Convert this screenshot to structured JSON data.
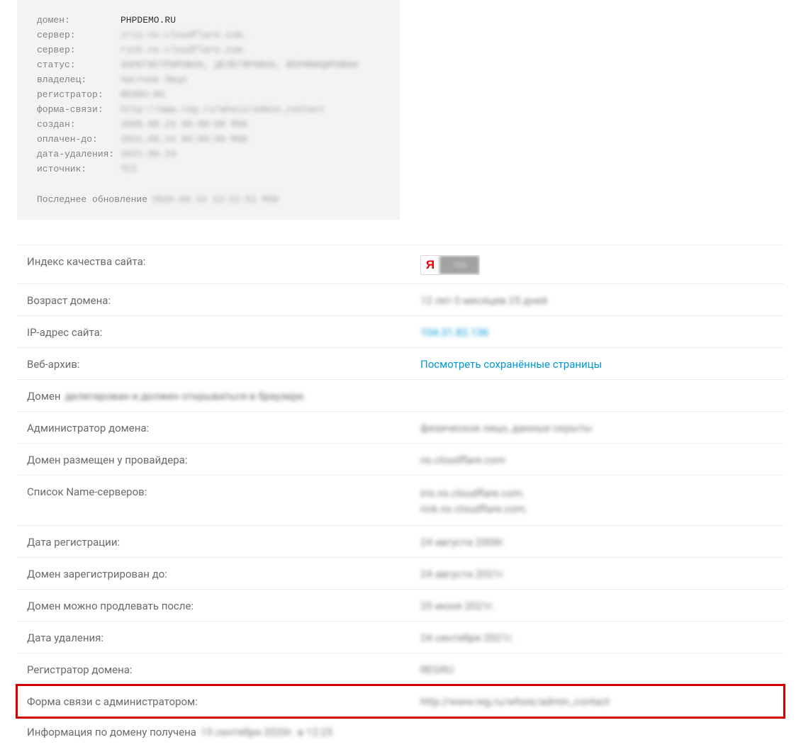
{
  "whois": {
    "rows": [
      {
        "label": "домен:",
        "value": "PHPDEMO.RU",
        "clear": true
      },
      {
        "label": "сервер:",
        "value": "iris.ns.cloudflare.com."
      },
      {
        "label": "сервер:",
        "value": "rick.ns.cloudflare.com."
      },
      {
        "label": "статус:",
        "value": "ЗАРЕГИСТРИРОВАН, ДЕЛЕГИРОВАН, ВЕРИФИЦИРОВАН"
      },
      {
        "label": "владелец:",
        "value": "Частное Лицо"
      },
      {
        "label": "регистратор:",
        "value": "REGRU-RU"
      },
      {
        "label": "форма-связи:",
        "value": "http://www.reg.ru/whois/admin_contact"
      },
      {
        "label": "создан:",
        "value": "2008.08.24 00:00:00 MSK"
      },
      {
        "label": "оплачен-до:",
        "value": "2021.08.24 00:00:00 MSK"
      },
      {
        "label": "дата-удаления:",
        "value": "2021.09.24"
      },
      {
        "label": "источник:",
        "value": "TCI"
      }
    ],
    "footer_label": "Последнее обновление",
    "footer_value": "2020.09.15 12:21:51 MSK"
  },
  "info": {
    "quality_label": "Индекс качества сайта:",
    "quality_badge_ya": "Я",
    "quality_badge_val": "120",
    "age_label": "Возраст домена:",
    "age_value": "12 лет 0 месяцев 25 дней",
    "ip_label": "IP-адрес сайта:",
    "ip_value": "104.31.82.136",
    "archive_label": "Веб-архив:",
    "archive_link": "Посмотреть сохранённые страницы",
    "domain_lead": "Домен",
    "domain_status": "делегирован и должен открываться в браузере.",
    "admin_label": "Администратор домена:",
    "admin_value": "физическое лицо, данные скрыты",
    "provider_label": "Домен размещен у провайдера:",
    "provider_value": "ns.cloudflare.com",
    "ns_label": "Список Name-серверов:",
    "ns_value_1": "iris.ns.cloudflare.com.",
    "ns_value_2": "rick.ns.cloudflare.com.",
    "reg_date_label": "Дата регистрации:",
    "reg_date_value": "24 августа 2008г.",
    "reg_until_label": "Домен зарегистрирован до:",
    "reg_until_value": "24 августа 2021г.",
    "renew_label": "Домен можно продлевать после:",
    "renew_value": "25 июня 2021г.",
    "delete_label": "Дата удаления:",
    "delete_value": "24 сентября 2021г.",
    "registrar_label": "Регистратор домена:",
    "registrar_value": "REGRU",
    "contact_label": "Форма связи с администратором:",
    "contact_value": "http://www.reg.ru/whois/admin_contact",
    "footer_lead": "Информация по домену получена",
    "footer_value": "15 сентября 2020г. в 12:25"
  }
}
